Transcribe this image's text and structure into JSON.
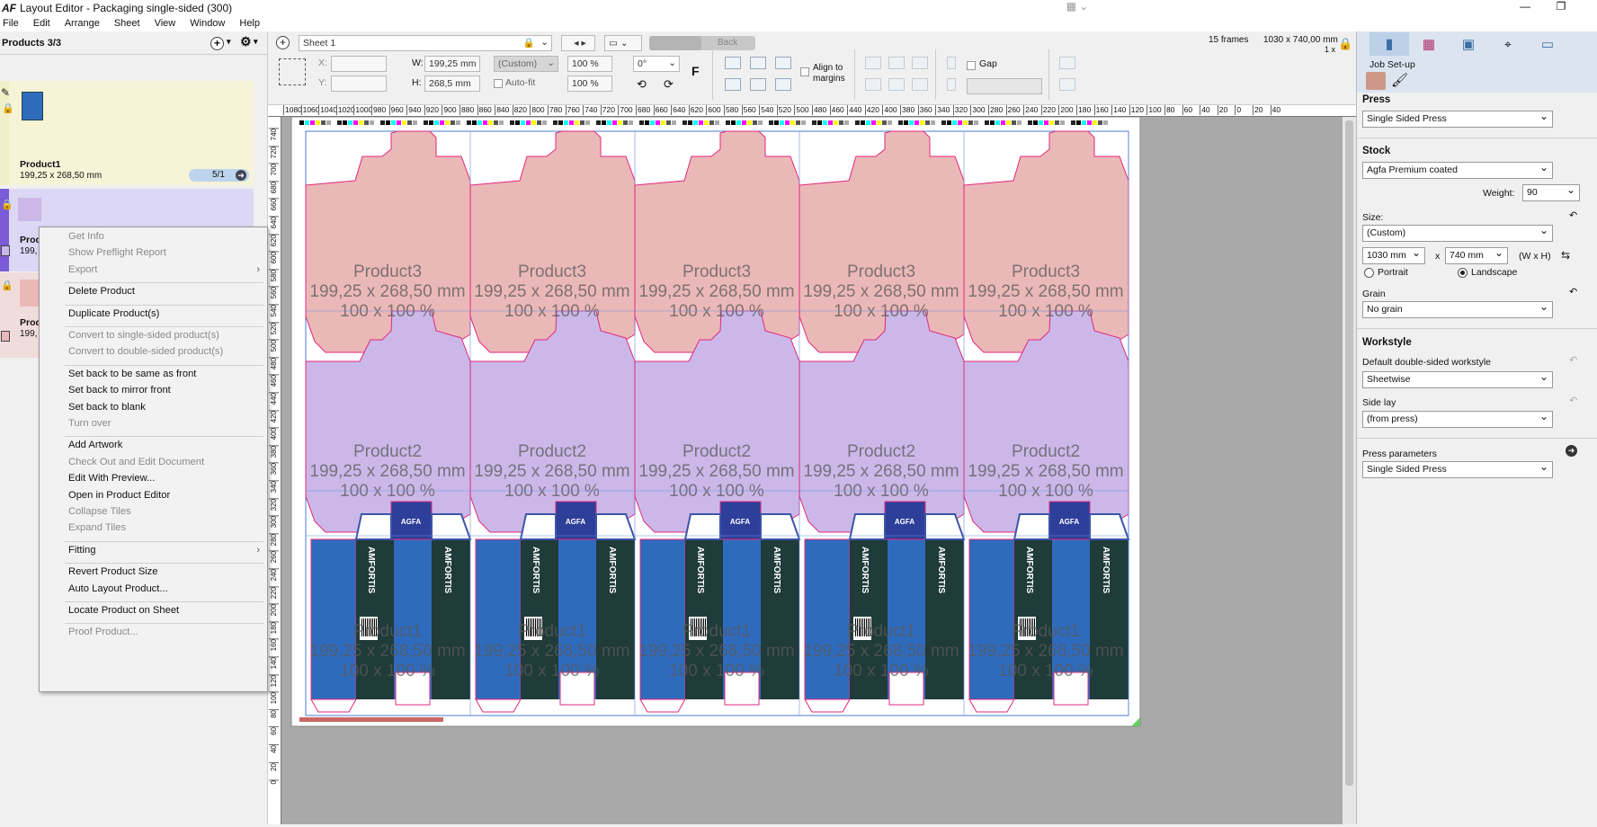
{
  "window": {
    "title": "Layout Editor - Packaging single-sided (300)",
    "logo": "AF",
    "min": "—",
    "max": "❐",
    "close": "✕"
  },
  "menu": [
    "File",
    "Edit",
    "Arrange",
    "Sheet",
    "View",
    "Window",
    "Help"
  ],
  "left": {
    "title": "Products 3/3",
    "product1": {
      "name": "Product1",
      "size": "199,25 x 268,50 mm",
      "count": "5/1"
    },
    "product2": {
      "name": "Prod",
      "size": "199,"
    },
    "product3": {
      "name": "Prod",
      "size": "199,"
    }
  },
  "context_menu": [
    {
      "label": "Get Info",
      "enabled": false
    },
    {
      "label": "Show Preflight Report",
      "enabled": false
    },
    {
      "label": "Export",
      "enabled": false,
      "submenu": true
    },
    {
      "sep": true
    },
    {
      "label": "Delete Product",
      "enabled": true
    },
    {
      "sep": true
    },
    {
      "label": "Duplicate Product(s)",
      "enabled": true
    },
    {
      "sep": true
    },
    {
      "label": "Convert to single-sided product(s)",
      "enabled": false
    },
    {
      "label": "Convert to double-sided product(s)",
      "enabled": false
    },
    {
      "sep": true
    },
    {
      "label": "Set back to be same as front",
      "enabled": true
    },
    {
      "label": "Set back to mirror front",
      "enabled": true
    },
    {
      "label": "Set back to blank",
      "enabled": true
    },
    {
      "label": "Turn over",
      "enabled": false
    },
    {
      "sep": true
    },
    {
      "label": "Add Artwork",
      "enabled": true
    },
    {
      "label": "Check Out and Edit Document",
      "enabled": false
    },
    {
      "label": "Edit With Preview...",
      "enabled": true
    },
    {
      "label": "Open in Product Editor",
      "enabled": true
    },
    {
      "label": "Collapse Tiles",
      "enabled": false
    },
    {
      "label": "Expand Tiles",
      "enabled": false
    },
    {
      "sep": true
    },
    {
      "label": "Fitting",
      "enabled": true,
      "submenu": true
    },
    {
      "sep": true
    },
    {
      "label": "Revert Product Size",
      "enabled": true
    },
    {
      "label": "Auto Layout Product...",
      "enabled": true
    },
    {
      "sep": true
    },
    {
      "label": "Locate Product on Sheet",
      "enabled": true
    },
    {
      "sep": true
    },
    {
      "label": "Proof Product...",
      "enabled": false
    }
  ],
  "toolbar": {
    "sheet": "Sheet 1",
    "back": "Back",
    "frames": "15 frames",
    "sheet_size": "1030 x 740,00 mm",
    "scale": "1 x",
    "x_label": "X:",
    "y_label": "Y:",
    "w_label": "W:",
    "h_label": "H:",
    "w_value": "199,25 mm",
    "h_value": "268,5 mm",
    "custom": "(Custom)",
    "auto_fit": "Auto-fit",
    "scale_x": "100 %",
    "scale_y": "100 %",
    "rotation": "0°",
    "flip": "F",
    "align_margins": "Align to margins",
    "gap": "Gap"
  },
  "ruler_h": [
    "1080",
    "1060",
    "1040",
    "1020",
    "1000",
    "980",
    "960",
    "940",
    "920",
    "900",
    "880",
    "860",
    "840",
    "820",
    "800",
    "780",
    "760",
    "740",
    "720",
    "700",
    "680",
    "660",
    "640",
    "620",
    "600",
    "580",
    "560",
    "540",
    "520",
    "500",
    "480",
    "460",
    "440",
    "420",
    "400",
    "380",
    "360",
    "340",
    "320",
    "300",
    "280",
    "260",
    "240",
    "220",
    "200",
    "180",
    "160",
    "140",
    "120",
    "100",
    "80",
    "60",
    "40",
    "20",
    "0",
    "20",
    "40"
  ],
  "ruler_v": [
    "740",
    "720",
    "700",
    "680",
    "660",
    "640",
    "620",
    "600",
    "580",
    "560",
    "540",
    "520",
    "500",
    "480",
    "460",
    "440",
    "420",
    "400",
    "380",
    "360",
    "340",
    "320",
    "300",
    "280",
    "260",
    "240",
    "220",
    "200",
    "180",
    "160",
    "140",
    "120",
    "100",
    "80",
    "60",
    "40",
    "20",
    "0"
  ],
  "tiles": {
    "product3": {
      "name": "Product3",
      "size": "199,25 x 268,50 mm",
      "scale": "100 x 100 %"
    },
    "product2": {
      "name": "Product2",
      "size": "199,25 x 268,50 mm",
      "scale": "100 x 100 %"
    },
    "product1": {
      "name": "Product1",
      "size": "199,25 x 268,50 mm",
      "scale": "100 x 100 %"
    },
    "brand": "AGFA",
    "box_text": "AMFORTIS"
  },
  "right": {
    "tab_label": "Job Set-up",
    "press_h": "Press",
    "press": "Single Sided Press",
    "stock_h": "Stock",
    "stock": "Agfa Premium coated",
    "weight_l": "Weight:",
    "weight": "90",
    "size_l": "Size:",
    "size": "(Custom)",
    "w": "1030 mm",
    "x": "x",
    "h": "740 mm",
    "wxh": "(W x H)",
    "portrait": "Portrait",
    "landscape": "Landscape",
    "grain_l": "Grain",
    "grain": "No grain",
    "workstyle_h": "Workstyle",
    "dsw_l": "Default double-sided workstyle",
    "dsw": "Sheetwise",
    "sidelay_l": "Side lay",
    "sidelay": "(from press)",
    "pp_l": "Press parameters",
    "pp": "Single Sided Press"
  },
  "colors": {
    "product3": "#ebb8b8",
    "product2": "#cbb8e8",
    "dieline": "#e0287c",
    "box_blue": "#2f6bbd",
    "box_dark": "#1f3b3a"
  }
}
